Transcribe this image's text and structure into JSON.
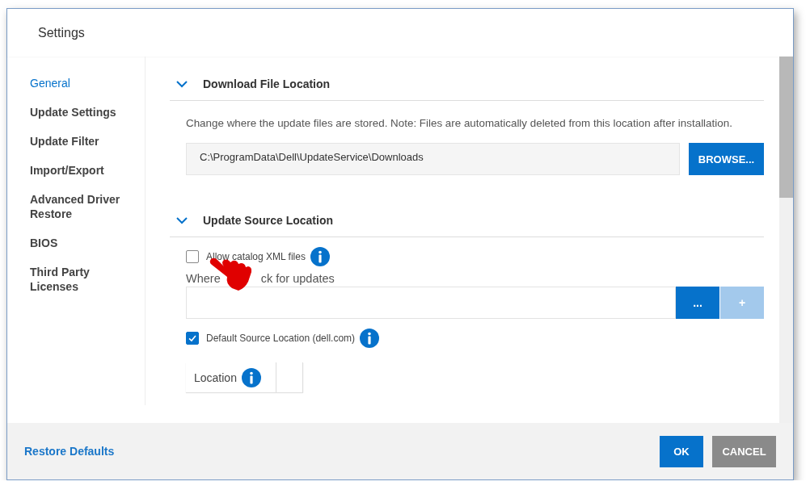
{
  "window": {
    "title": "Settings"
  },
  "sidebar": {
    "items": [
      {
        "label": "General",
        "selected": true
      },
      {
        "label": "Update Settings",
        "selected": false
      },
      {
        "label": "Update Filter",
        "selected": false
      },
      {
        "label": "Import/Export",
        "selected": false
      },
      {
        "label": "Advanced Driver Restore",
        "selected": false
      },
      {
        "label": "BIOS",
        "selected": false
      },
      {
        "label": "Third Party Licenses",
        "selected": false
      }
    ]
  },
  "download_section": {
    "title": "Download File Location",
    "expanded": true,
    "description": "Change where the update files are stored. Note: Files are automatically deleted from this location after installation.",
    "path_field": {
      "value": "C:\\ProgramData\\Dell\\UpdateService\\Downloads"
    },
    "browse_button": "BROWSE..."
  },
  "source_section": {
    "title": "Update Source Location",
    "expanded": true,
    "allow_catalog": {
      "label": "Allow catalog XML files",
      "checked": false
    },
    "where_label": [
      "Where",
      "ck for updates"
    ],
    "browse_button": {
      "label": "...",
      "disabled": false
    },
    "add_button": {
      "label": "+",
      "disabled": true
    },
    "default_source": {
      "label": "Default Source Location (dell.com)",
      "checked": true
    },
    "table": {
      "columns": [
        "Location"
      ]
    }
  },
  "footer": {
    "restore_link": "Restore Defaults",
    "buttons": [
      {
        "label": "OK",
        "kind": "primary"
      },
      {
        "label": "CANCEL",
        "kind": "secondary"
      }
    ]
  }
}
